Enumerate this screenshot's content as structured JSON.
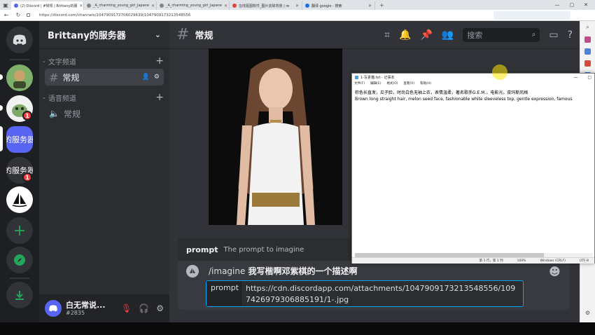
{
  "browser": {
    "tabs": [
      {
        "label": "(2) Discord | #常规 | Brittany的服",
        "active": true
      },
      {
        "label": "_A_charming_young_girl_Japane",
        "active": false
      },
      {
        "label": "_A_charming_young_girl_Japane",
        "active": false
      },
      {
        "label": "在线抠图软件_图片去除背景 | re",
        "active": false
      },
      {
        "label": "翻译 google - 搜索",
        "active": false
      }
    ],
    "url": "https://discord.com/channels/1047909172706029639/1047909173213548556"
  },
  "server": {
    "name": "Brittany的服务器",
    "guild_labels": {
      "selected": "的服务器",
      "other": "的服务器"
    },
    "badges": [
      "1",
      "1"
    ]
  },
  "channels": {
    "text_category": "文字频道",
    "text_channel": "常规",
    "voice_category": "语音频道",
    "voice_channel": "常规"
  },
  "user": {
    "name": "白无常说...",
    "tag": "#2835"
  },
  "header": {
    "channel": "常规",
    "search_placeholder": "搜索"
  },
  "command": {
    "option_name": "prompt",
    "option_desc": "The prompt to imagine",
    "slash": "/imagine",
    "text": "我写楷啊邓紫棋的一个描述啊",
    "prompt_key": "prompt",
    "prompt_value": "https://cdn.discordapp.com/attachments/1047909173213548556/1097426979306885191/1-.jpg"
  },
  "notepad": {
    "title": "1-写素猫.txt - 记事本",
    "menu": [
      "文件(F)",
      "编辑(E)",
      "格式(O)",
      "查看(V)",
      "帮助(H)"
    ],
    "line1": "棕色长直发，瓜子脸，时尚白色无袖上衣，表情温柔，著名歌手G.E.M.，电影光，皮玛斯风格",
    "line2": "Brown long straight hair, melon seed face, fashionable white sleeveless top, gentle expression, famous",
    "status": [
      "第 1 行，第 1 列",
      "100%",
      "Windows (CRLF)",
      "UTF-8"
    ]
  },
  "colors": {
    "blurple": "#5865f2",
    "green": "#23a55a",
    "red": "#f23f43"
  }
}
